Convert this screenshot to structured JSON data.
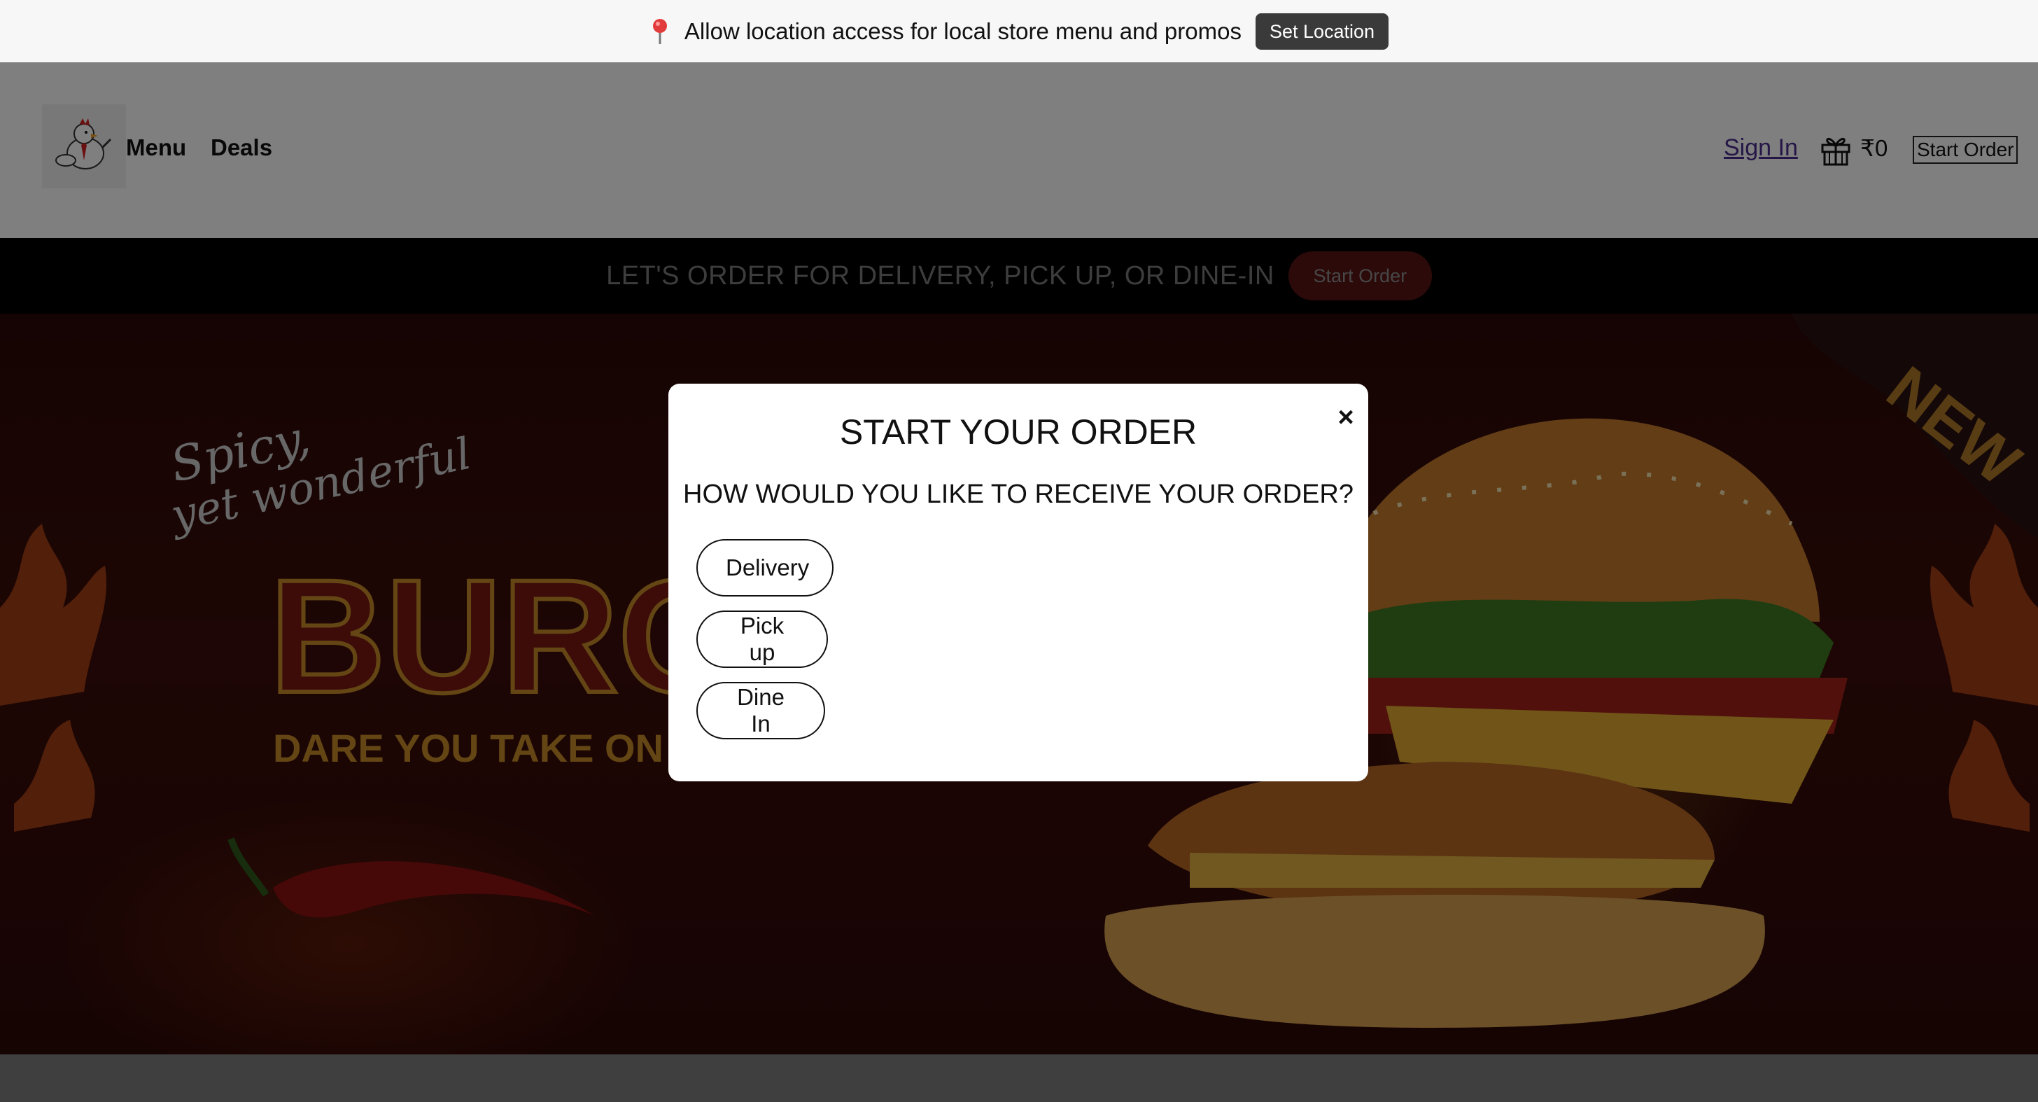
{
  "location_banner": {
    "text": "Allow location access for local store menu and promos",
    "button_label": "Set Location",
    "icon": "map-pin-icon"
  },
  "header": {
    "logo": "chicken-mascot-logo",
    "nav": [
      {
        "label": "Menu"
      },
      {
        "label": "Deals"
      }
    ],
    "sign_in_label": "Sign In",
    "rewards_icon": "gift-icon",
    "points": "₹0",
    "start_order_label": "Start Order"
  },
  "order_bar": {
    "text": "LET'S ORDER FOR DELIVERY, PICK UP, OR DINE-IN",
    "button_label": "Start Order"
  },
  "modal": {
    "title": "START YOUR ORDER",
    "subtitle": "HOW WOULD YOU LIKE TO RECEIVE YOUR ORDER?",
    "close_label": "×",
    "options": [
      {
        "label": "Delivery"
      },
      {
        "label": "Pick up"
      },
      {
        "label": "Dine In"
      }
    ]
  },
  "hero": {
    "tagline": "Spicy, yet wonderful",
    "headline": "BURGER",
    "slogan": "DARE YOU TAKE ON THE CHALLENGE",
    "badge": "NEW"
  },
  "colors": {
    "banner_bg": "#f7f7f7",
    "location_button": "#3a3a3a",
    "order_bar_bg": "#000000",
    "order_bar_button": "#5a1414",
    "sign_in_link": "#4b2c8f"
  }
}
